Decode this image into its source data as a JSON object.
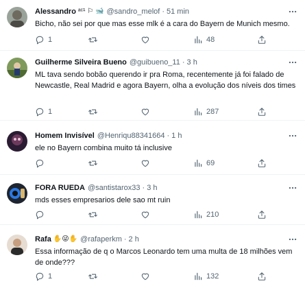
{
  "tweets": [
    {
      "name": "Alessandro",
      "badges": "ᵃᶜ¹ ⚐ 🐋",
      "handle": "@sandro_melof",
      "time": "51 min",
      "text": "Bicho, não sei por que mas esse mlk é a cara do Bayern de Munich mesmo.",
      "replies": "1",
      "views": "48",
      "avatar_color": "#8a8f86"
    },
    {
      "name": "Guilherme Silveira Bueno",
      "badges": "",
      "handle": "@guibueno_11",
      "time": "3 h",
      "text": "ML tava sendo bobão querendo ir pra Roma, recentemente já foi falado de Newcastle, Real Madrid e agora Bayern, olha a evolução dos níveis dos times",
      "replies": "1",
      "views": "287",
      "avatar_color": "#5f7d44"
    },
    {
      "name": "Homem Invisível",
      "badges": "",
      "handle": "@Henriqu88341664",
      "time": "1 h",
      "text": "ele no Bayern combina muito tá inclusive",
      "replies": "",
      "views": "69",
      "avatar_color": "#3a1f4a"
    },
    {
      "name": "FORA RUEDA",
      "badges": "",
      "handle": "@santistarox33",
      "time": "3 h",
      "text": "mds esses empresarios dele sao mt ruin",
      "replies": "",
      "views": "210",
      "avatar_color": "#2a6fd6"
    },
    {
      "name": "Rafa",
      "badges": "✋😜✋",
      "handle": "@rafaperkm",
      "time": "2 h",
      "text": "Essa informação de q o Marcos Leonardo tem uma multa de 18 milhões vem de onde???",
      "replies": "1",
      "views": "132",
      "avatar_color": "#c9b5a3"
    }
  ],
  "colors": {
    "text": "#0f1419",
    "secondary": "#536471",
    "separator": "#eff3f4",
    "verified_like_blue": "#1d9bf0"
  },
  "icons": {
    "more": "more-dots-icon",
    "reply": "reply-icon",
    "retweet": "retweet-icon",
    "like": "like-icon",
    "views": "views-icon",
    "share": "share-icon"
  }
}
